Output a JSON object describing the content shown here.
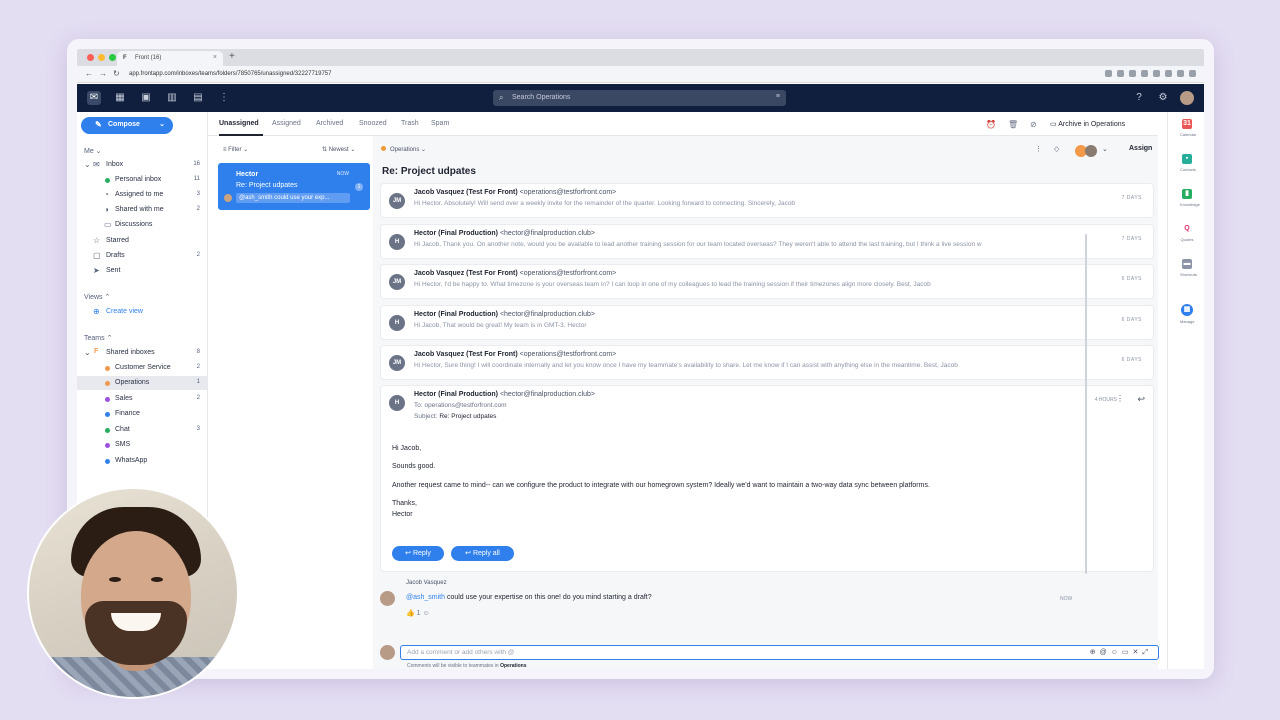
{
  "browser": {
    "tab_title": "Front (16)",
    "url": "app.frontapp.com/inboxes/teams/folders/7850765/unassigned/32227719757"
  },
  "search": {
    "placeholder": "Search Operations"
  },
  "sidebar": {
    "compose": "Compose",
    "me_label": "Me",
    "inbox": {
      "label": "Inbox",
      "count": "16"
    },
    "inbox_items": [
      {
        "label": "Personal inbox",
        "count": "11",
        "color": "#27ae60"
      },
      {
        "label": "Assigned to me",
        "count": "3",
        "color": ""
      },
      {
        "label": "Shared with me",
        "count": "2",
        "color": ""
      },
      {
        "label": "Discussions",
        "count": "",
        "color": ""
      }
    ],
    "starred": "Starred",
    "drafts": {
      "label": "Drafts",
      "count": "2"
    },
    "sent": "Sent",
    "views_label": "Views",
    "create_view": "Create view",
    "teams_label": "Teams",
    "shared_inboxes": {
      "label": "Shared inboxes",
      "count": "8"
    },
    "team_items": [
      {
        "label": "Customer Service",
        "count": "2",
        "color": "#f2994a"
      },
      {
        "label": "Operations",
        "count": "1",
        "color": "#f2994a"
      },
      {
        "label": "Sales",
        "count": "2",
        "color": "#9b51e0"
      },
      {
        "label": "Finance",
        "count": "",
        "color": "#2f80ed"
      },
      {
        "label": "Chat",
        "count": "3",
        "color": "#27ae60"
      },
      {
        "label": "SMS",
        "count": "",
        "color": "#9b51e0"
      },
      {
        "label": "WhatsApp",
        "count": "",
        "color": "#2f80ed"
      }
    ]
  },
  "tabs": [
    "Unassigned",
    "Assigned",
    "Archived",
    "Snoozed",
    "Trash",
    "Spam"
  ],
  "list": {
    "filter": "Filter",
    "sort": "Newest",
    "card": {
      "name": "Hector",
      "subject": "Re: Project udpates",
      "time": "NOW",
      "badge": "1",
      "preview": "@ash_smith could use your exp..."
    }
  },
  "conversation": {
    "inbox": "Operations",
    "subject": "Re: Project udpates",
    "archive": "Archive in Operations",
    "assign": "Assign",
    "messages": [
      {
        "initials": "JM",
        "name": "Jacob Vasquez (Test For Front)",
        "email": "<operations@testforfront.com>",
        "preview": "Hi Hector, Absolutely! Will send over a weekly invite for the remainder of the quarter. Looking forward to connecting. Sincerely, Jacob",
        "when": "7 DAYS"
      },
      {
        "initials": "H",
        "name": "Hector (Final Production)",
        "email": "<hector@finalproduction.club>",
        "preview": "Hi Jacob, Thank you. On another note, would you be available to lead another training session for our team located overseas? They weren't able to attend the last training, but I think a live session w",
        "when": "7 DAYS"
      },
      {
        "initials": "JM",
        "name": "Jacob Vasquez (Test For Front)",
        "email": "<operations@testforfront.com>",
        "preview": "Hi Hector, I'd be happy to. What timezone is your overseas team in? I can loop in one of my colleagues to lead the training session if their timezones align more closely. Best, Jacob",
        "when": "6 DAYS"
      },
      {
        "initials": "H",
        "name": "Hector (Final Production)",
        "email": "<hector@finalproduction.club>",
        "preview": "Hi Jacob, That would be great! My team is in GMT-3. Hector",
        "when": "6 DAYS"
      },
      {
        "initials": "JM",
        "name": "Jacob Vasquez (Test For Front)",
        "email": "<operations@testforfront.com>",
        "preview": "Hi Hector, Sure thing! I will coordinate internally and let you know once I have my teammate's availability to share. Let me know if I can assist with anything else in the meantime. Best, Jacob",
        "when": "6 DAYS"
      }
    ],
    "open": {
      "initials": "H",
      "name": "Hector (Final Production)",
      "email": "<hector@finalproduction.club>",
      "to": "To: operations@testforfront.com",
      "subject_label": "Subject:",
      "subject": "Re: Project udpates",
      "when": "4 HOURS",
      "body": [
        "Hi Jacob,",
        "Sounds good.",
        "Another request came to mind-- can we configure the product to integrate with our homegrown system? Ideally we'd want to maintain a two-way data sync between platforms.",
        "Thanks,",
        "Hector"
      ],
      "reply": "Reply",
      "reply_all": "Reply all"
    },
    "comment": {
      "author": "Jacob Vasquez",
      "mention": "@ash_smith",
      "text": " could use your expertise on this one! do you mind starting a draft?",
      "time": "NOW",
      "reaction": "👍 1"
    },
    "comment_box": {
      "placeholder": "Add a comment or add others with @",
      "note_prefix": "Comments will be visible to teammates in",
      "note_inbox": "Operations"
    }
  },
  "rail": [
    {
      "label": "Calendar",
      "glyph": "31",
      "color": "#eb5757"
    },
    {
      "label": "Contacts",
      "glyph": "▪",
      "color": "#27ae9b"
    },
    {
      "label": "Knowledge",
      "glyph": "▮",
      "color": "#27ae60"
    },
    {
      "label": "Quotes",
      "glyph": "Q",
      "color": "#ffffff"
    },
    {
      "label": "Shortcuts",
      "glyph": "▬",
      "color": "#8b93a6"
    },
    {
      "label": "Manage",
      "glyph": "▦",
      "color": "#2f80ed"
    }
  ]
}
